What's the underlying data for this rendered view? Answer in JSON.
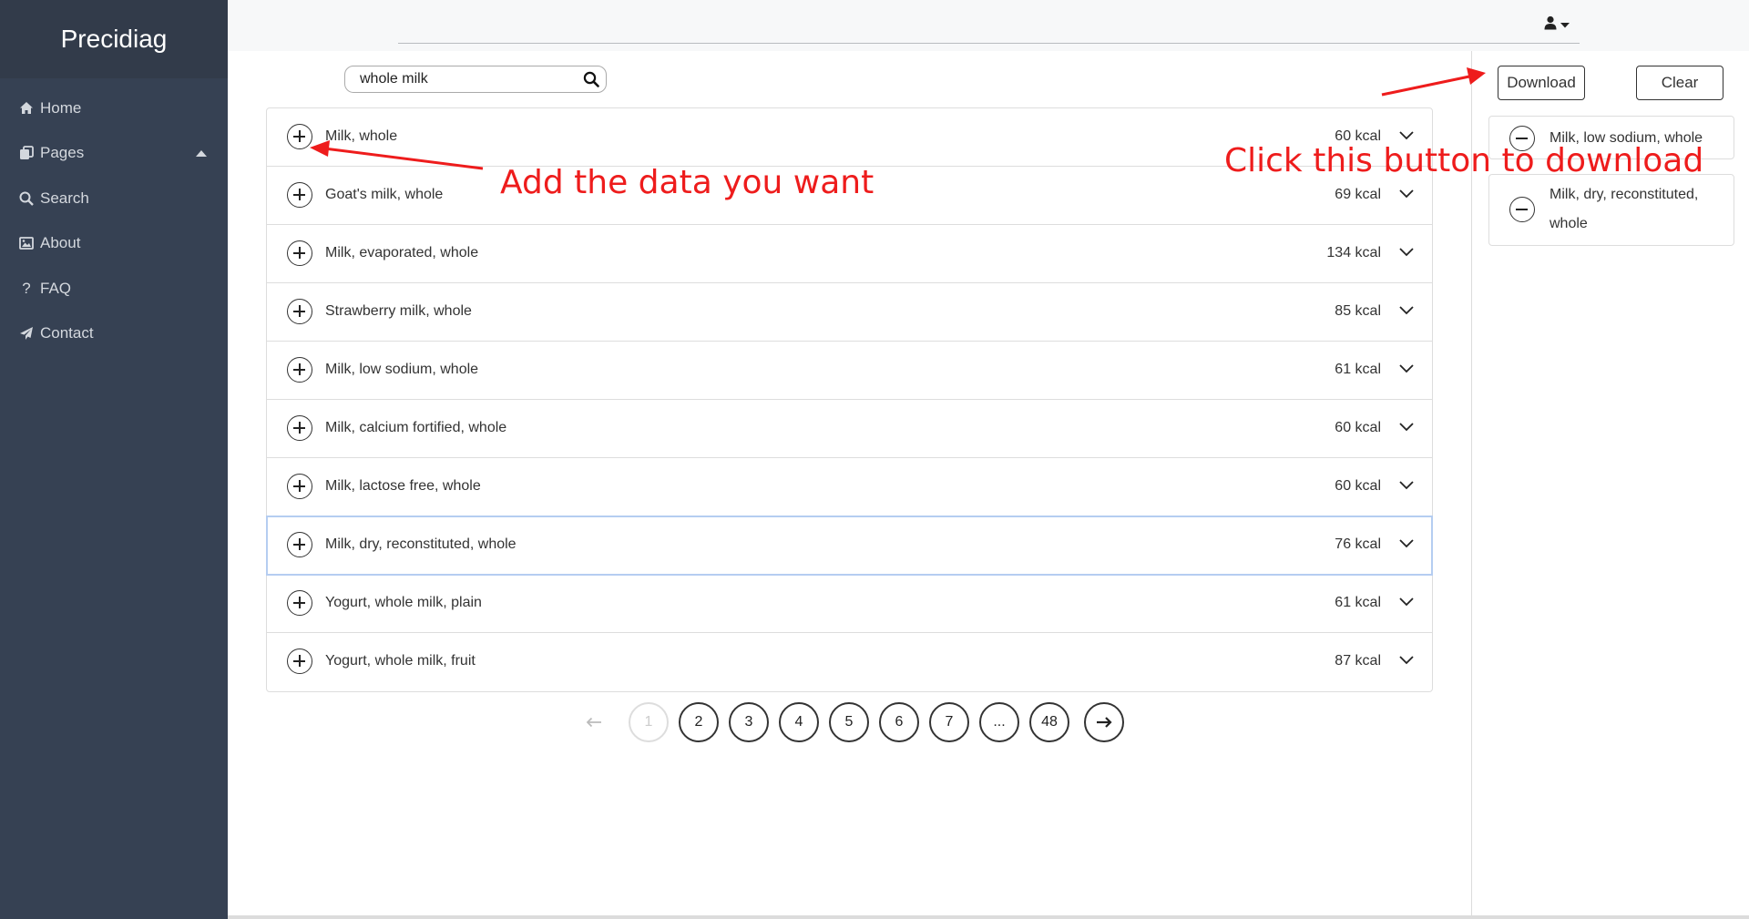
{
  "brand": "Precidiag",
  "sidebar": {
    "items": [
      {
        "label": "Home",
        "icon": "home-icon"
      },
      {
        "label": "Pages",
        "icon": "pages-icon"
      },
      {
        "label": "Search",
        "icon": "search-icon"
      },
      {
        "label": "About",
        "icon": "image-icon"
      },
      {
        "label": "FAQ",
        "icon": "question-icon"
      },
      {
        "label": "Contact",
        "icon": "send-icon"
      }
    ]
  },
  "search": {
    "value": "whole milk"
  },
  "results": [
    {
      "name": "Milk, whole",
      "kcal": "60 kcal"
    },
    {
      "name": "Goat's milk, whole",
      "kcal": "69 kcal"
    },
    {
      "name": "Milk, evaporated, whole",
      "kcal": "134 kcal"
    },
    {
      "name": "Strawberry milk, whole",
      "kcal": "85 kcal"
    },
    {
      "name": "Milk, low sodium, whole",
      "kcal": "61 kcal"
    },
    {
      "name": "Milk, calcium fortified, whole",
      "kcal": "60 kcal"
    },
    {
      "name": "Milk, lactose free, whole",
      "kcal": "60 kcal"
    },
    {
      "name": "Milk, dry, reconstituted, whole",
      "kcal": "76 kcal"
    },
    {
      "name": "Yogurt, whole milk, plain",
      "kcal": "61 kcal"
    },
    {
      "name": "Yogurt, whole milk, fruit",
      "kcal": "87 kcal"
    }
  ],
  "pagination": {
    "pages": [
      "1",
      "2",
      "3",
      "4",
      "5",
      "6",
      "7",
      "...",
      "48"
    ],
    "current": "1"
  },
  "actions": {
    "download": "Download",
    "clear": "Clear"
  },
  "selected": [
    {
      "name": "Milk, low sodium, whole"
    },
    {
      "name": "Milk, dry, reconstituted,",
      "name2": "whole"
    }
  ],
  "annotations": {
    "add": "Add the data you want",
    "download": "Click this button to download",
    "color": "#ee1c1c"
  },
  "colors": {
    "sidebar": "#364153",
    "highlight": "#b5cdf1"
  }
}
